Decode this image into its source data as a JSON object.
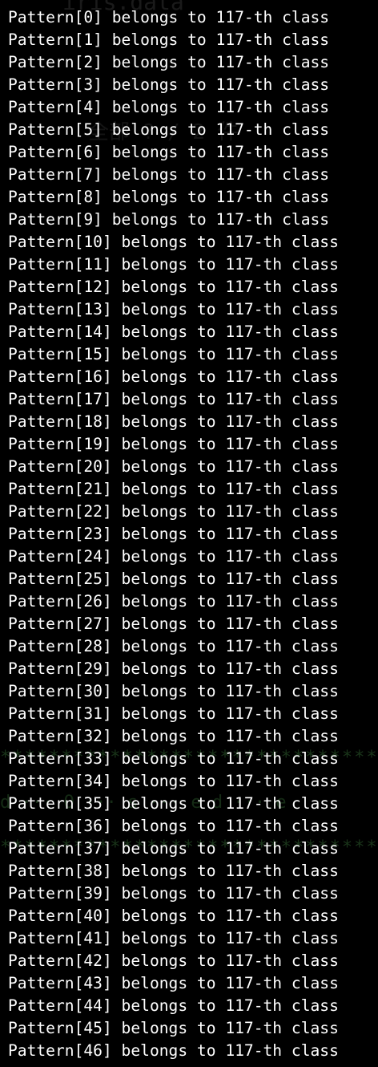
{
  "background_color": "#000000",
  "text_color": "#ffffff",
  "ghost_color": "#2f5f2f",
  "background_ghost": {
    "title": "iris.data",
    "sub": "全部 ? / 2 件",
    "stars_top": "***************************************",
    "stars_bottom": "***************************************",
    "middle": "d ··· O ··· s ··· e d ··· e"
  },
  "output_lines": [
    "Pattern[0] belongs to 117-th class",
    "Pattern[1] belongs to 117-th class",
    "Pattern[2] belongs to 117-th class",
    "Pattern[3] belongs to 117-th class",
    "Pattern[4] belongs to 117-th class",
    "Pattern[5] belongs to 117-th class",
    "Pattern[6] belongs to 117-th class",
    "Pattern[7] belongs to 117-th class",
    "Pattern[8] belongs to 117-th class",
    "Pattern[9] belongs to 117-th class",
    "Pattern[10] belongs to 117-th class",
    "Pattern[11] belongs to 117-th class",
    "Pattern[12] belongs to 117-th class",
    "Pattern[13] belongs to 117-th class",
    "Pattern[14] belongs to 117-th class",
    "Pattern[15] belongs to 117-th class",
    "Pattern[16] belongs to 117-th class",
    "Pattern[17] belongs to 117-th class",
    "Pattern[18] belongs to 117-th class",
    "Pattern[19] belongs to 117-th class",
    "Pattern[20] belongs to 117-th class",
    "Pattern[21] belongs to 117-th class",
    "Pattern[22] belongs to 117-th class",
    "Pattern[23] belongs to 117-th class",
    "Pattern[24] belongs to 117-th class",
    "Pattern[25] belongs to 117-th class",
    "Pattern[26] belongs to 117-th class",
    "Pattern[27] belongs to 117-th class",
    "Pattern[28] belongs to 117-th class",
    "Pattern[29] belongs to 117-th class",
    "Pattern[30] belongs to 117-th class",
    "Pattern[31] belongs to 117-th class",
    "Pattern[32] belongs to 117-th class",
    "Pattern[33] belongs to 117-th class",
    "Pattern[34] belongs to 117-th class",
    "Pattern[35] belongs to 117-th class",
    "Pattern[36] belongs to 117-th class",
    "Pattern[37] belongs to 117-th class",
    "Pattern[38] belongs to 117-th class",
    "Pattern[39] belongs to 117-th class",
    "Pattern[40] belongs to 117-th class",
    "Pattern[41] belongs to 117-th class",
    "Pattern[42] belongs to 117-th class",
    "Pattern[43] belongs to 117-th class",
    "Pattern[44] belongs to 117-th class",
    "Pattern[45] belongs to 117-th class",
    "Pattern[46] belongs to 117-th class"
  ]
}
